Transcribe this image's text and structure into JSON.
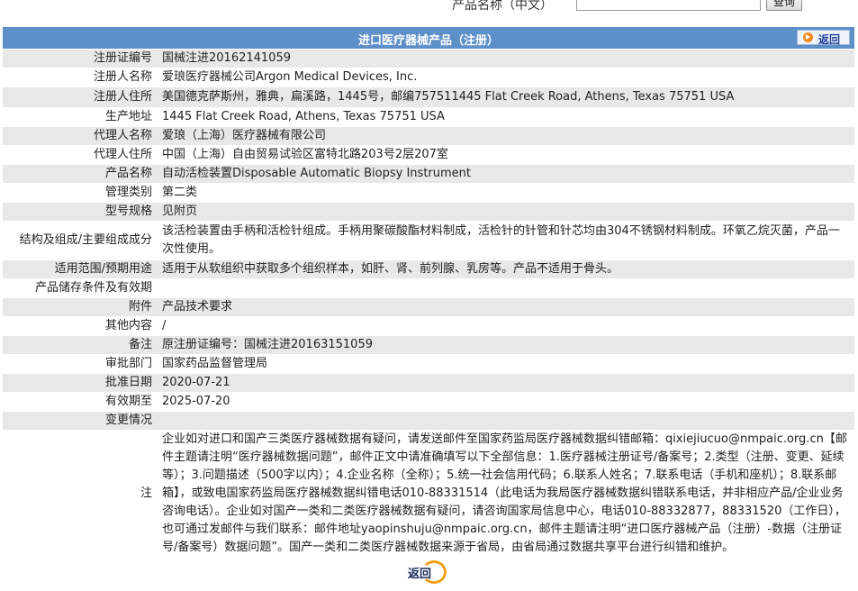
{
  "search": {
    "label": "产品名称（中文）",
    "value": "",
    "button": "查询"
  },
  "header": {
    "title": "进口医疗器械产品（注册）",
    "back_label": "返回"
  },
  "rows": [
    {
      "key": "注册证编号",
      "value": "国械注进20162141059"
    },
    {
      "key": "注册人名称",
      "value": "爱琅医疗器械公司Argon Medical Devices, Inc."
    },
    {
      "key": "注册人住所",
      "value": "美国德克萨斯州，雅典，扁溪路，1445号，邮编757511445 Flat Creek Road, Athens, Texas 75751 USA"
    },
    {
      "key": "生产地址",
      "value": "1445 Flat Creek Road, Athens, Texas 75751 USA"
    },
    {
      "key": "代理人名称",
      "value": "爱琅（上海）医疗器械有限公司"
    },
    {
      "key": "代理人住所",
      "value": "中国（上海）自由贸易试验区富特北路203号2层207室"
    },
    {
      "key": "产品名称",
      "value": "自动活检装置Disposable Automatic Biopsy Instrument"
    },
    {
      "key": "管理类别",
      "value": "第二类"
    },
    {
      "key": "型号规格",
      "value": "见附页"
    },
    {
      "key": "结构及组成/主要组成成分",
      "value": "该活检装置由手柄和活检针组成。手柄用聚碳酸酯材料制成，活检针的针管和针芯均由304不锈钢材料制成。环氧乙烷灭菌，产品一次性使用。"
    },
    {
      "key": "适用范围/预期用途",
      "value": "适用于从软组织中获取多个组织样本，如肝、肾、前列腺、乳房等。产品不适用于骨头。"
    },
    {
      "key": "产品储存条件及有效期",
      "value": ""
    },
    {
      "key": "附件",
      "value": "产品技术要求"
    },
    {
      "key": "其他内容",
      "value": "/"
    },
    {
      "key": "备注",
      "value": "原注册证编号：国械注进20163151059"
    },
    {
      "key": "审批部门",
      "value": "国家药品监督管理局"
    },
    {
      "key": "批准日期",
      "value": "2020-07-21"
    },
    {
      "key": "有效期至",
      "value": "2025-07-20"
    },
    {
      "key": "变更情况",
      "value": ""
    }
  ],
  "notice": {
    "key": "注",
    "text": "企业如对进口和国产三类医疗器械数据有疑问，请发送邮件至国家药监局医疗器械数据纠错邮箱：qixiejiucuo@nmpaic.org.cn【邮件主题请注明“医疗器械数据问题”，邮件正文中请准确填写以下全部信息：1.医疗器械注册证号/备案号；2.类型（注册、变更、延续等）；3.问题描述（500字以内）；4.企业名称（全称）；5.统一社会信用代码；6.联系人姓名；7.联系电话（手机和座机）；8.联系邮箱】，或致电国家药监局医疗器械数据纠错电话010-88331514（此电话为我局医疗器械数据纠错联系电话，并非相应产品/企业业务咨询电话）。企业如对国产一类和二类医疗器械数据有疑问，请咨询国家局信息中心，电话010-88332877，88331520（工作日），也可通过发邮件与我们联系：邮件地址yaopinshuju@nmpaic.org.cn，邮件主题请注明“进口医疗器械产品（注册）-数据（注册证号/备案号）数据问题”。国产一类和二类医疗器械数据来源于省局，由省局通过数据共享平台进行纠错和维护。"
  },
  "footer": {
    "back_label": "返回"
  }
}
